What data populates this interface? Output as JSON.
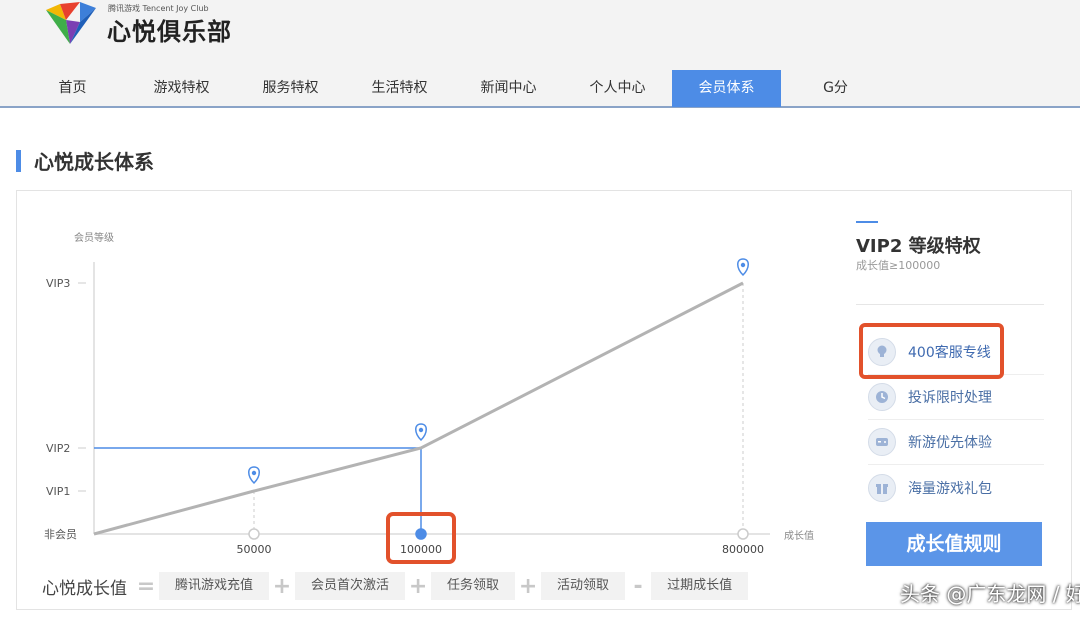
{
  "header": {
    "logo_small": "腾讯游戏 Tencent Joy Club",
    "logo_main": "心悦俱乐部",
    "nav": [
      "首页",
      "游戏特权",
      "服务特权",
      "生活特权",
      "新闻中心",
      "个人中心",
      "会员体系",
      "G分"
    ],
    "active_nav": "会员体系"
  },
  "section": {
    "title": "心悦成长体系"
  },
  "chart_data": {
    "type": "line",
    "ylabel": "会员等级",
    "xlabel": "成长值",
    "y_categories": [
      "非会员",
      "VIP1",
      "VIP2",
      "VIP3"
    ],
    "x_ticks": [
      "50000",
      "100000",
      "800000"
    ],
    "series": [
      {
        "points": [
          {
            "x": 0,
            "y": "非会员"
          },
          {
            "x": 50000,
            "y": "VIP1"
          },
          {
            "x": 100000,
            "y": "VIP2"
          },
          {
            "x": 800000,
            "y": "VIP3"
          }
        ]
      }
    ],
    "highlight": {
      "x": "100000",
      "y": "VIP2"
    },
    "colors": {
      "line": "#b3b3b3",
      "accent": "#4d8ce6",
      "highlight_box": "#e2512b"
    }
  },
  "formula": {
    "label": "心悦成长值",
    "eq": "=",
    "items": [
      {
        "op": "",
        "text": "腾讯游戏充值"
      },
      {
        "op": "+",
        "text": "会员首次激活"
      },
      {
        "op": "+",
        "text": "任务领取"
      },
      {
        "op": "+",
        "text": "活动领取"
      },
      {
        "op": "-",
        "text": "过期成长值"
      }
    ]
  },
  "sidebar": {
    "title": "VIP2 等级特权",
    "subtitle": "成长值≥100000",
    "privileges": [
      {
        "label": "400客服专线",
        "icon": "lightbulb-icon"
      },
      {
        "label": "投诉限时处理",
        "icon": "clock-icon"
      },
      {
        "label": "新游优先体验",
        "icon": "gamepad-icon"
      },
      {
        "label": "海量游戏礼包",
        "icon": "gift-icon"
      }
    ],
    "rules_button": "成长值规则"
  },
  "watermark": "头条 @广东龙网 / 好机友"
}
